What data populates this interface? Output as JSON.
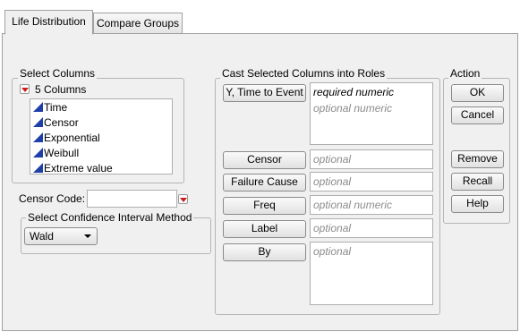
{
  "tabs": [
    {
      "label": "Life Distribution",
      "active": true
    },
    {
      "label": "Compare Groups",
      "active": false
    }
  ],
  "select_columns": {
    "title": "Select Columns",
    "count_label": "5 Columns",
    "columns": [
      "Time",
      "Censor",
      "Exponential",
      "Weibull",
      "Extreme value"
    ]
  },
  "censor_code": {
    "label": "Censor Code:",
    "value": ""
  },
  "ci_method": {
    "title": "Select Confidence Interval Method",
    "selected": "Wald"
  },
  "cast_roles": {
    "title": "Cast Selected Columns into Roles",
    "roles": [
      {
        "button": "Y, Time to Event",
        "hints": [
          "required numeric",
          "optional numeric"
        ]
      },
      {
        "button": "Censor",
        "hints": [
          "optional"
        ]
      },
      {
        "button": "Failure Cause",
        "hints": [
          "optional"
        ]
      },
      {
        "button": "Freq",
        "hints": [
          "optional numeric"
        ]
      },
      {
        "button": "Label",
        "hints": [
          "optional"
        ]
      },
      {
        "button": "By",
        "hints": [
          "optional"
        ]
      }
    ]
  },
  "action": {
    "title": "Action",
    "buttons": [
      "OK",
      "Cancel",
      "Remove",
      "Recall",
      "Help"
    ]
  },
  "colors": {
    "panel_bg": "#f0f0f0",
    "hint_text": "#8c8c8c",
    "menu_triangle": "#cc1e1e",
    "continuous_icon": "#1f3fa8"
  }
}
